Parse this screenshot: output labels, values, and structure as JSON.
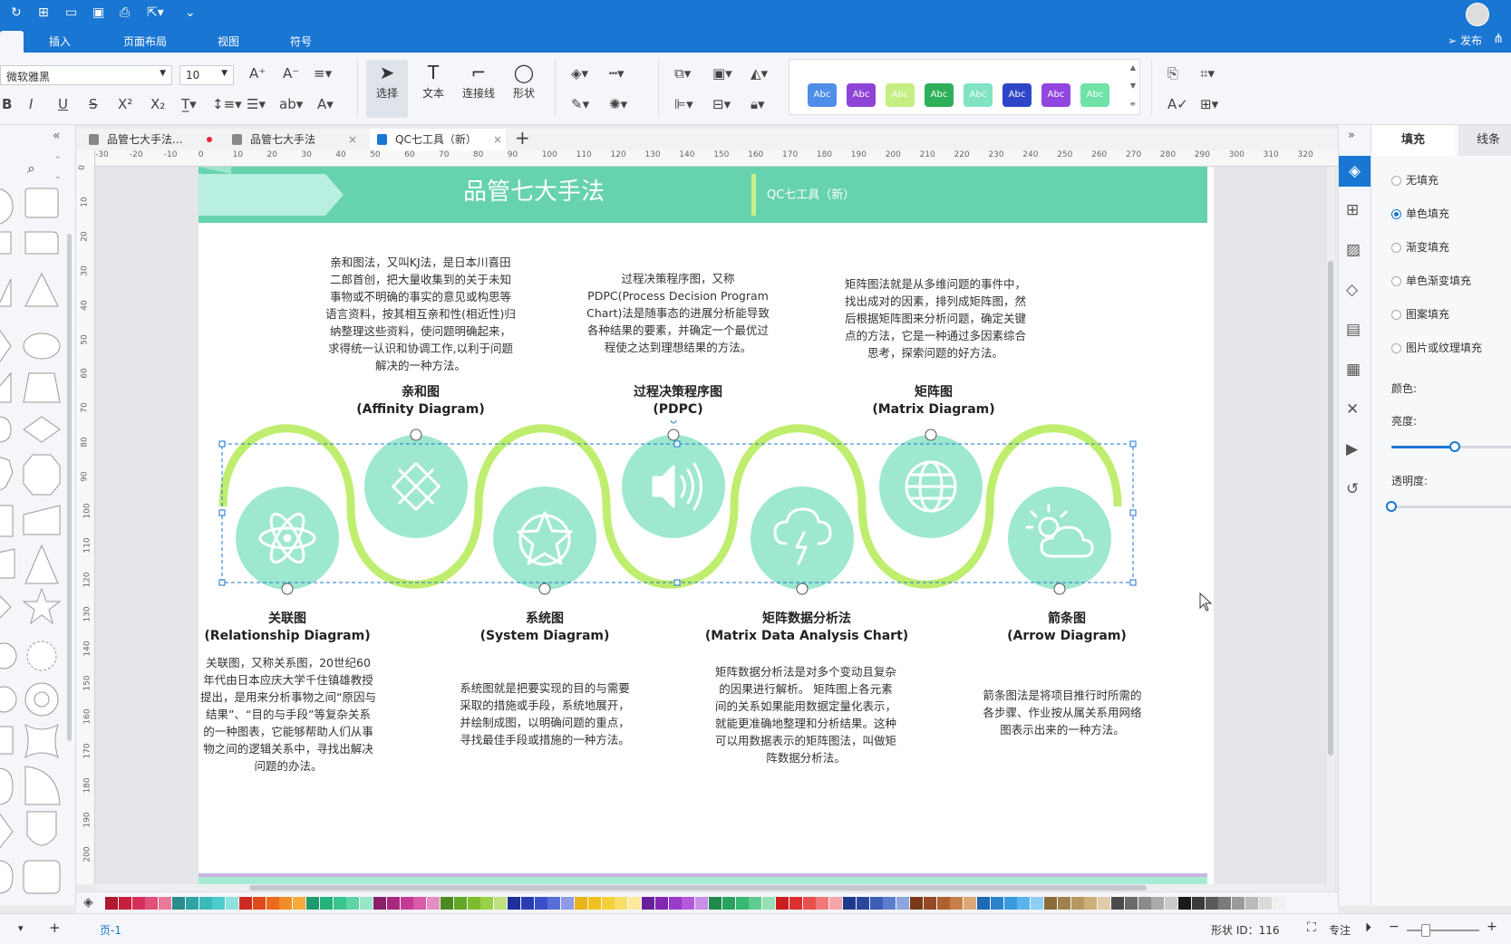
{
  "menu": {
    "items": [
      "插入",
      "页面布局",
      "视图",
      "符号"
    ],
    "publish": "发布"
  },
  "ribbon": {
    "font_name": "微软雅黑",
    "font_size": "10",
    "tools": [
      "选择",
      "文本",
      "连接线",
      "形状"
    ],
    "style_swatches": [
      {
        "label": "Abc",
        "color": "#4e8ee8"
      },
      {
        "label": "Abc",
        "color": "#8e44d6"
      },
      {
        "label": "Abc",
        "color": "#c5ef82"
      },
      {
        "label": "Abc",
        "color": "#2eaf5a"
      },
      {
        "label": "Abc",
        "color": "#7fe3c4"
      },
      {
        "label": "Abc",
        "color": "#2f45c7"
      },
      {
        "label": "Abc",
        "color": "#9146e0"
      },
      {
        "label": "Abc",
        "color": "#6fe2a6"
      }
    ]
  },
  "tabs": [
    {
      "label": "品管七大手法...",
      "modified": true
    },
    {
      "label": "品管七大手法",
      "modified": false
    },
    {
      "label": "QC七工具（新）",
      "modified": false
    }
  ],
  "ruler_top": [
    "-30",
    "-20",
    "-10",
    "0",
    "10",
    "20",
    "30",
    "40",
    "50",
    "60",
    "70",
    "80",
    "90",
    "100",
    "110",
    "120",
    "130",
    "140",
    "150",
    "160",
    "170",
    "180",
    "190",
    "200",
    "210",
    "220",
    "230",
    "240",
    "250",
    "260",
    "270",
    "280",
    "290",
    "300",
    "310",
    "320"
  ],
  "ruler_left": [
    "0",
    "10",
    "20",
    "30",
    "40",
    "50",
    "60",
    "70",
    "80",
    "90",
    "100",
    "110",
    "120",
    "130",
    "140",
    "150",
    "160",
    "170",
    "180",
    "190",
    "200"
  ],
  "diagram": {
    "title": "品管七大手法",
    "subtitle": "QC七工具（新）",
    "colors": {
      "banner": "#66d2ae",
      "wave": "#bfee6f",
      "circle": "#9ee8d0"
    },
    "top_items": [
      {
        "name_cn": "亲和图",
        "name_en": "(Affinity Diagram)",
        "icon": "puzzle-icon",
        "desc": "亲和图法，又叫KJ法，是日本川喜田二郎首创，把大量收集到的关于未知事物或不明确的事实的意见或构思等语言资料，按其相互亲和性(相近性)归纳整理这些资料，使问题明确起来，求得统一认识和协调工作,以利于问题解决的一种方法。"
      },
      {
        "name_cn": "过程决策程序图",
        "name_en": "(PDPC)",
        "icon": "speaker-icon",
        "desc": "过程决策程序图，又称PDPC(Process Decision Program Chart)法是随事态的进展分析能导致各种结果的要素，并确定一个最优过程使之达到理想结果的方法。"
      },
      {
        "name_cn": "矩阵图",
        "name_en": "(Matrix Diagram)",
        "icon": "globe-icon",
        "desc": "矩阵图法就是从多维问题的事件中，找出成对的因素，排列成矩阵图，然后根据矩阵图来分析问题，确定关键点的方法，它是一种通过多因素综合思考，探索问题的好方法。"
      }
    ],
    "bottom_items": [
      {
        "name_cn": "关联图",
        "name_en": "(Relationship Diagram)",
        "icon": "atom-icon",
        "desc": "关联图，又称关系图，20世纪60年代由日本应庆大学千住镇雄教授提出，是用来分析事物之间“原因与结果”、“目的与手段”等复杂关系的一种图表，它能够帮助人们从事物之间的逻辑关系中，寻找出解决问题的办法。"
      },
      {
        "name_cn": "系统图",
        "name_en": "(System Diagram)",
        "icon": "star-icon",
        "desc": "系统图就是把要实现的目的与需要采取的措施或手段，系统地展开，并绘制成图，以明确问题的重点，寻找最佳手段或措施的一种方法。"
      },
      {
        "name_cn": "矩阵数据分析法",
        "name_en": "(Matrix Data Analysis Chart)",
        "icon": "storm-icon",
        "desc": "矩阵数据分析法是对多个变动且复杂的因果进行解析。 矩阵图上各元素间的关系如果能用数据定量化表示，就能更准确地整理和分析结果。这种可以用数据表示的矩阵图法，叫做矩阵数据分析法。"
      },
      {
        "name_cn": "箭条图",
        "name_en": "(Arrow Diagram)",
        "icon": "sun-cloud-icon",
        "desc": "箭条图法是将项目推行时所需的各步骤、作业按从属关系用网络图表示出来的一种方法。"
      }
    ]
  },
  "right_panel": {
    "tabs": [
      "填充",
      "线条"
    ],
    "fill_options": [
      "无填充",
      "单色填充",
      "渐变填充",
      "单色渐变填充",
      "图案填充",
      "图片或纹理填充"
    ],
    "selected_option": 1,
    "color_label": "颜色:",
    "brightness_label": "亮度:",
    "brightness_value": 0.5,
    "opacity_label": "透明度:",
    "opacity_value": 0
  },
  "palette": [
    "#b0182c",
    "#c8203c",
    "#d4305a",
    "#e0507a",
    "#e97899",
    "#2a8c8c",
    "#2fa3a3",
    "#3bb8b8",
    "#4ccccc",
    "#8fe0e0",
    "#cc2b1f",
    "#e04a1a",
    "#ea6a1f",
    "#f08c2a",
    "#f5aa3a",
    "#1f9a6a",
    "#26b27d",
    "#38c48f",
    "#5ed4a8",
    "#9ae6c8",
    "#8a1f6a",
    "#a8287f",
    "#c43a96",
    "#d85aaa",
    "#e68ec4",
    "#4c8a1f",
    "#62a626",
    "#7cbc2f",
    "#9ad048",
    "#bfe080",
    "#1f2e9a",
    "#2a3cb4",
    "#3a50c8",
    "#5a6ed8",
    "#8e9ce6",
    "#e8b41a",
    "#f0c21f",
    "#f5d03a",
    "#f8de6a",
    "#fbeaa0",
    "#6a1f9a",
    "#8228b4",
    "#9a3ac8",
    "#b25ad8",
    "#ca8ee6",
    "#1f8a4c",
    "#28a25e",
    "#38b872",
    "#5ecc90",
    "#98e0b6",
    "#c81f1f",
    "#dc2f2f",
    "#e85050",
    "#f07878",
    "#f5a6a6",
    "#1f3a8a",
    "#28489e",
    "#3a5eb4",
    "#5a7ecc",
    "#8ea6e0",
    "#7a3a1a",
    "#944a24",
    "#ae6030",
    "#c88048",
    "#dca878",
    "#1f6ab4",
    "#2a82cc",
    "#3a9ae0",
    "#5ab4ec",
    "#8ecef4",
    "#8a6a3a",
    "#a0804a",
    "#b8985e",
    "#ccb07c",
    "#e0cca8",
    "#4a4a4a",
    "#6a6a6a",
    "#8a8a8a",
    "#aaaaaa",
    "#cacaca",
    "#1a1a1a",
    "#3a3a3a",
    "#5a5a5a",
    "#7a7a7a",
    "#9a9a9a",
    "#bababa",
    "#dadada",
    "#f0f0f0"
  ],
  "status": {
    "page_name": "页-1",
    "shape_id": "形状 ID：116",
    "focus": "专注"
  }
}
